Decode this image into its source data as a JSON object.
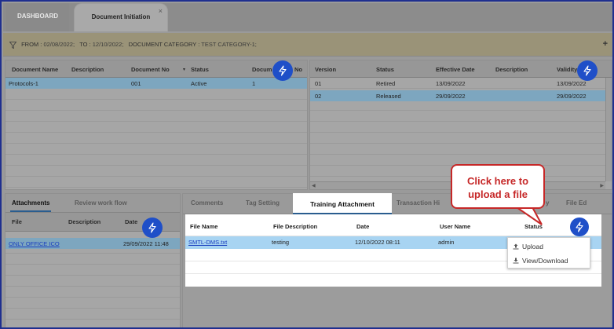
{
  "tabs": {
    "dashboard": "DASHBOARD",
    "document_initiation": "Document Initiation",
    "close": "×"
  },
  "filter": {
    "from_label": "FROM :",
    "from_value": "02/08/2022;",
    "to_label": "TO :",
    "to_value": "12/10/2022;",
    "category_label": "DOCUMENT CATEGORY :",
    "category_value": "TEST CATEGORY-1;",
    "expand": "+"
  },
  "documents": {
    "columns": [
      "Document Name",
      "Description",
      "Document No",
      "Status",
      "Docum",
      "No"
    ],
    "rows": [
      {
        "name": "Protocols-1",
        "description": "",
        "doc_no": "001",
        "status": "Active",
        "version": "1"
      }
    ]
  },
  "versions": {
    "columns": [
      "Version",
      "Status",
      "Effective Date",
      "Description",
      "Validity"
    ],
    "rows": [
      {
        "version": "01",
        "status": "Retired",
        "effective_date": "13/09/2022",
        "description": "",
        "validity": "13/09/2022"
      },
      {
        "version": "02",
        "status": "Released",
        "effective_date": "29/09/2022",
        "description": "",
        "validity": "29/09/2022"
      }
    ]
  },
  "attachments_panel": {
    "tabs": [
      "Attachments",
      "Review work flow"
    ],
    "columns": [
      "File",
      "Description",
      "Date"
    ],
    "rows": [
      {
        "file": "ONLY OFFICE ICO",
        "description": "",
        "date": "29/09/2022 11:48"
      }
    ]
  },
  "detail_tabs": [
    "Comments",
    "Tag Setting",
    "Training Attachment",
    "Transaction Hi",
    "y",
    "File Ed"
  ],
  "training": {
    "columns": [
      "File Name",
      "File Description",
      "Date",
      "User Name",
      "Status"
    ],
    "rows": [
      {
        "file_name": "SMTL-DMS.txt",
        "file_description": "testing",
        "date": "12/10/2022 08:11",
        "user_name": "admin",
        "status": ""
      }
    ]
  },
  "menu": {
    "upload": "Upload",
    "view_download": "View/Download"
  },
  "callout": {
    "line1": "Click here to",
    "line2": "upload a file"
  },
  "colors": {
    "accent": "#1f4fc8",
    "callout": "#c62828",
    "selected_row": "#a8d4f2"
  }
}
